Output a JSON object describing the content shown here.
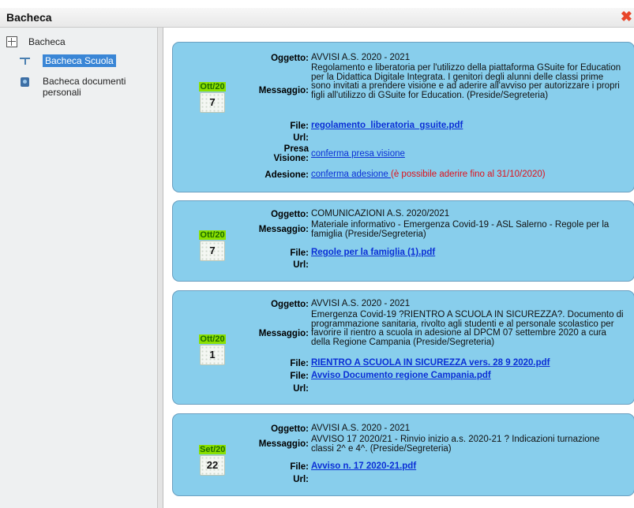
{
  "window": {
    "title": "Bacheca",
    "close_glyph": "✖"
  },
  "tree": {
    "root_label": "Bacheca",
    "items": [
      {
        "label": "Bacheca Scuola",
        "icon": "board-icon",
        "selected": true
      },
      {
        "label": "Bacheca documenti personali",
        "icon": "document-icon",
        "selected": false
      }
    ]
  },
  "labels": {
    "oggetto": "Oggetto:",
    "messaggio": "Messaggio:",
    "file": "File:",
    "url": "Url:",
    "presa_visione": "Presa Visione:",
    "adesione": "Adesione:"
  },
  "cards": [
    {
      "month": "Ott/20",
      "day": "7",
      "oggetto": "AVVISI A.S. 2020 - 2021",
      "messaggio": "Regolamento e liberatoria per l'utilizzo della piattaforma GSuite for Education per la Didattica Digitale Integrata. I genitori degli alunni delle classi prime sono invitati a prendere visione e ad aderire all'avviso per autorizzare i propri figli all'utilizzo di GSuite for Education. (Preside/Segreteria)",
      "files": [
        "regolamento_liberatoria_gsuite.pdf"
      ],
      "url": "",
      "presa_visione": "conferma presa visione",
      "adesione": "conferma adesione ",
      "adesione_note": "(è possibile aderire fino al 31/10/2020)"
    },
    {
      "month": "Ott/20",
      "day": "7",
      "oggetto": "COMUNICAZIONI A.S. 2020/2021",
      "messaggio": "Materiale informativo - Emergenza Covid-19 - ASL Salerno - Regole per la famiglia (Preside/Segreteria)",
      "files": [
        "Regole per la famiglia (1).pdf"
      ],
      "url": ""
    },
    {
      "month": "Ott/20",
      "day": "1",
      "oggetto": "AVVISI A.S. 2020 - 2021",
      "messaggio": "Emergenza Covid-19 ?RIENTRO A SCUOLA IN SICUREZZA?. Documento di programmazione sanitaria, rivolto agli studenti e al personale scolastico per favorire il rientro a scuola in adesione al DPCM 07 settembre 2020 a cura della Regione Campania (Preside/Segreteria)",
      "files": [
        "RIENTRO A SCUOLA IN SICUREZZA vers. 28 9 2020.pdf",
        "Avviso Documento regione Campania.pdf"
      ],
      "url": ""
    },
    {
      "month": "Set/20",
      "day": "22",
      "oggetto": "AVVISI A.S. 2020 - 2021",
      "messaggio": "AVVISO 17 2020/21 - Rinvio inizio a.s. 2020-21 ? Indicazioni turnazione classi 2^ e 4^. (Preside/Segreteria)",
      "files": [
        "Avviso n. 17 2020-21.pdf"
      ],
      "url": ""
    }
  ]
}
